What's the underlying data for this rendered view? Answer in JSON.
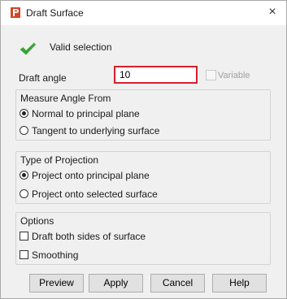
{
  "window": {
    "title": "Draft Surface",
    "close_glyph": "×",
    "app_icon": "powermill-p-icon",
    "accent_color": "#d24726"
  },
  "status": {
    "icon": "green-check-icon",
    "icon_color": "#3aa535",
    "text": "Valid selection"
  },
  "draft_angle": {
    "label": "Draft angle",
    "value": "10",
    "input_border_color": "#d6202c",
    "variable_label": "Variable",
    "variable_checked": false,
    "variable_enabled": false
  },
  "measure_angle": {
    "legend": "Measure Angle From",
    "options": [
      {
        "label": "Normal to principal plane",
        "selected": true
      },
      {
        "label": "Tangent to underlying surface",
        "selected": false
      }
    ]
  },
  "projection": {
    "legend": "Type of Projection",
    "options": [
      {
        "label": "Project onto principal plane",
        "selected": true
      },
      {
        "label": "Project onto selected surface",
        "selected": false
      }
    ]
  },
  "options": {
    "legend": "Options",
    "items": [
      {
        "label": "Draft both sides of surface",
        "checked": false
      },
      {
        "label": "Smoothing",
        "checked": false
      }
    ]
  },
  "buttons": {
    "preview": "Preview",
    "apply": "Apply",
    "cancel": "Cancel",
    "help": "Help"
  }
}
